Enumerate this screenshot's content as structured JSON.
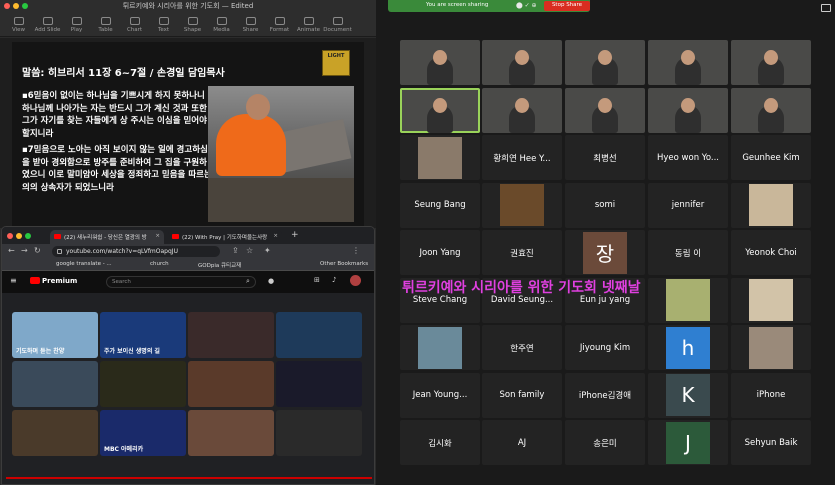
{
  "keynote": {
    "window_title": "튀르키예와 시리아를 위한 기도회 — Edited",
    "toolbar": [
      "View",
      "Add Slide",
      "Play",
      "Table",
      "Chart",
      "Text",
      "Shape",
      "Media",
      "Share",
      "Format",
      "Animate",
      "Document"
    ],
    "slide": {
      "title": "말씀: 히브리서 11장 6~7절 / 손경일 담임목사",
      "logo_text": "LIGHT",
      "paragraphs": [
        "▪6믿음이 없이는 하나님을 기쁘시게 하지 못하나니 하나님께 나아가는 자는 반드시 그가 계신 것과 또한 그가 자기를 찾는 자들에게 상 주시는 이심을 믿어야 할지니라",
        "▪7믿음으로 노아는 아직 보이지 않는 일에 경고하심을 받아 경외함으로 방주를 준비하여 그 집을 구원하였으니 이로 말미암아 세상을 정죄하고 믿음을 따르는 의의 상속자가 되었느니라"
      ]
    }
  },
  "chrome": {
    "tabs": [
      "(22) 새누리워쉽 - 당신은 열광의 방",
      "(22) With Pray | 기도하며울는사랑"
    ],
    "url": "youtube.com/watch?v=qLVfmOapqJU",
    "bookmarks": [
      "google translate - ...",
      "church",
      "GODpia 큐티교재",
      "Other Bookmarks"
    ],
    "youtube": {
      "logo": "Premium",
      "search_placeholder": "Search",
      "thumbnails": [
        {
          "title": "기도하며 듣는 찬양",
          "color": "#7fa8c9"
        },
        {
          "title": "주가 보이신 생명의 길",
          "color": "#1a3a7a"
        },
        {
          "title": "",
          "color": "#3a2a2a"
        },
        {
          "title": "",
          "color": "#1e3a5a"
        },
        {
          "title": "",
          "color": "#3a4a5a"
        },
        {
          "title": "",
          "color": "#2a2a1a"
        },
        {
          "title": "",
          "color": "#5a3a2a"
        },
        {
          "title": "",
          "color": "#1a1a2a"
        },
        {
          "title": "",
          "color": "#4a3a2a"
        },
        {
          "title": "MBC 아메리카",
          "color": "#1a2a6a"
        },
        {
          "title": "",
          "color": "#6a4a3a"
        },
        {
          "title": "",
          "color": "#2a2a2a"
        }
      ]
    }
  },
  "zoom": {
    "share_text": "You are screen sharing",
    "stop_label": "Stop Share",
    "overlay_text": "튀르키예와 시리아를 위한 기도회 넷째날",
    "participants": [
      {
        "name": "",
        "type": "video"
      },
      {
        "name": "",
        "type": "video"
      },
      {
        "name": "",
        "type": "video"
      },
      {
        "name": "",
        "type": "video"
      },
      {
        "name": "",
        "type": "video"
      },
      {
        "name": "",
        "type": "video-active"
      },
      {
        "name": "",
        "type": "video"
      },
      {
        "name": "",
        "type": "video"
      },
      {
        "name": "",
        "type": "video"
      },
      {
        "name": "",
        "type": "video"
      },
      {
        "name": "",
        "type": "photo"
      },
      {
        "name": "황희연 Hee Y...",
        "type": "name"
      },
      {
        "name": "최병선",
        "type": "name"
      },
      {
        "name": "Hyeo won Yo...",
        "type": "name"
      },
      {
        "name": "Geunhee Kim",
        "type": "name"
      },
      {
        "name": "Seung Bang",
        "type": "name"
      },
      {
        "name": "",
        "type": "photo"
      },
      {
        "name": "somi",
        "type": "name"
      },
      {
        "name": "jennifer",
        "type": "name"
      },
      {
        "name": "",
        "type": "photo"
      },
      {
        "name": "Joon Yang",
        "type": "name"
      },
      {
        "name": "권효진",
        "type": "name"
      },
      {
        "name": "장",
        "type": "letter"
      },
      {
        "name": "동림 이",
        "type": "name"
      },
      {
        "name": "Yeonok Choi",
        "type": "name"
      },
      {
        "name": "Steve Chang",
        "type": "name"
      },
      {
        "name": "David Seung...",
        "type": "name"
      },
      {
        "name": "Eun ju yang",
        "type": "name"
      },
      {
        "name": "",
        "type": "photo"
      },
      {
        "name": "",
        "type": "photo"
      },
      {
        "name": "",
        "type": "photo"
      },
      {
        "name": "한주연",
        "type": "name"
      },
      {
        "name": "Jiyoung Kim",
        "type": "name"
      },
      {
        "name": "h",
        "type": "letter"
      },
      {
        "name": "",
        "type": "photo"
      },
      {
        "name": "Jean Young...",
        "type": "name"
      },
      {
        "name": "Son family",
        "type": "name"
      },
      {
        "name": "iPhone김경애",
        "type": "name"
      },
      {
        "name": "K",
        "type": "letter"
      },
      {
        "name": "iPhone",
        "type": "name"
      },
      {
        "name": "김시화",
        "type": "name"
      },
      {
        "name": "AJ",
        "type": "name"
      },
      {
        "name": "송은미",
        "type": "name"
      },
      {
        "name": "J",
        "type": "letter"
      },
      {
        "name": "Sehyun Baik",
        "type": "name"
      }
    ]
  },
  "colors": {
    "zoom_active": "#9ad35a",
    "overlay": "#e040e0",
    "stop": "#d92d20",
    "letter_jang": "#6b4a3a",
    "letter_h": "#2f7fd1",
    "letter_k": "#3a4a4e",
    "letter_j": "#2c5a3a"
  }
}
